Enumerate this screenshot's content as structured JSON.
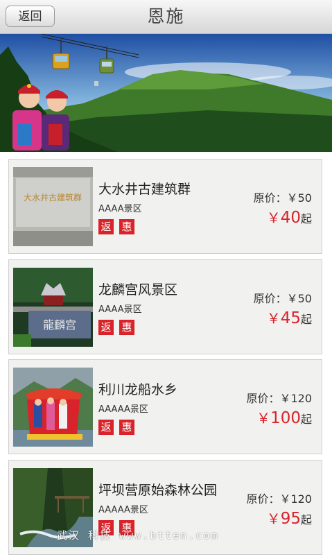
{
  "header": {
    "back_label": "返回",
    "title": "恩施"
  },
  "spots": [
    {
      "name": "大水井古建筑群",
      "grade": "AAAA景区",
      "orig_label": "原价：",
      "orig_price": "￥50",
      "yen": "￥",
      "price": "40",
      "suffix": "起",
      "tag_fan": "返",
      "tag_hui": "惠",
      "thumb_text": "大水井古建筑群"
    },
    {
      "name": "龙麟宫风景区",
      "grade": "AAAA景区",
      "orig_label": "原价：",
      "orig_price": "￥50",
      "yen": "￥",
      "price": "45",
      "suffix": "起",
      "tag_fan": "返",
      "tag_hui": "惠",
      "thumb_text": "龍麟宫"
    },
    {
      "name": "利川龙船水乡",
      "grade": "AAAAA景区",
      "orig_label": "原价：",
      "orig_price": "￥120",
      "yen": "￥",
      "price": "100",
      "suffix": "起",
      "tag_fan": "返",
      "tag_hui": "惠"
    },
    {
      "name": "坪坝营原始森林公园",
      "grade": "AAAAA景区",
      "orig_label": "原价：",
      "orig_price": "￥120",
      "yen": "￥",
      "price": "95",
      "suffix": "起",
      "tag_fan": "返",
      "tag_hui": "惠"
    }
  ],
  "watermark": "武汉 科技 www.btten.com",
  "colors": {
    "accent_red": "#d8232a",
    "card_bg": "#f1f1f0"
  }
}
